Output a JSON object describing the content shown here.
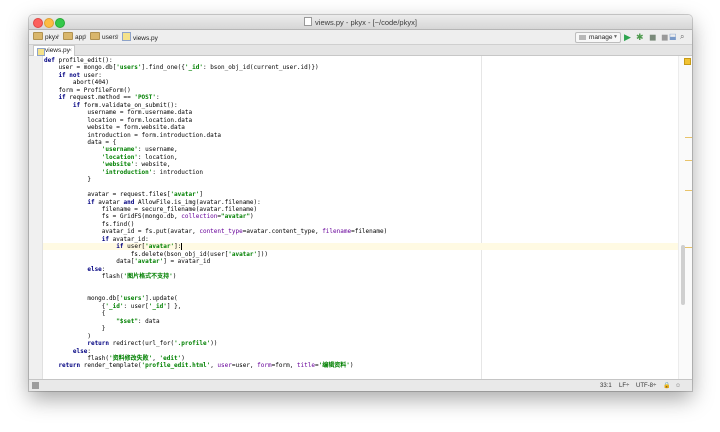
{
  "window": {
    "title": "views.py - pkyx - [~/code/pkyx]"
  },
  "breadcrumb": {
    "items": [
      {
        "label": "pkyx",
        "kind": "folder"
      },
      {
        "label": "app",
        "kind": "folder"
      },
      {
        "label": "users",
        "kind": "folder"
      },
      {
        "label": "views.py",
        "kind": "python-file"
      }
    ]
  },
  "toolbar": {
    "run_config": "manage",
    "icons": [
      "run-icon",
      "debug-icon",
      "coverage-icon",
      "stop-icon",
      "vcs-icon",
      "search-icon"
    ]
  },
  "tabs": [
    {
      "label": "views.py",
      "active": true
    }
  ],
  "editor": {
    "lines": [
      [
        [
          "kw",
          "def "
        ],
        [
          "",
          "profile_edit():"
        ]
      ],
      [
        [
          "",
          "    user = mongo.db["
        ],
        [
          "st",
          "'users'"
        ],
        [
          "",
          "].find_one({"
        ],
        [
          "st",
          "'_id'"
        ],
        [
          "",
          ": bson_obj_id(current_user.id)})"
        ]
      ],
      [
        [
          "kw",
          "    if not "
        ],
        [
          "",
          "user:"
        ]
      ],
      [
        [
          "",
          "        abort("
        ],
        [
          "",
          "404"
        ],
        [
          "",
          ")"
        ]
      ],
      [
        [
          "",
          "    form = ProfileForm()"
        ]
      ],
      [
        [
          "kw",
          "    if "
        ],
        [
          "",
          "request.method == "
        ],
        [
          "st",
          "'POST'"
        ],
        [
          "",
          ":"
        ]
      ],
      [
        [
          "kw",
          "        if "
        ],
        [
          "",
          "form.validate_on_submit():"
        ]
      ],
      [
        [
          "",
          "            username = form.username.data"
        ]
      ],
      [
        [
          "",
          "            location = form.location.data"
        ]
      ],
      [
        [
          "",
          "            website = form.website.data"
        ]
      ],
      [
        [
          "",
          "            introduction = form.introduction.data"
        ]
      ],
      [
        [
          "",
          "            data = {"
        ]
      ],
      [
        [
          "st",
          "                'username'"
        ],
        [
          "",
          ": username,"
        ]
      ],
      [
        [
          "st",
          "                'location'"
        ],
        [
          "",
          ": location,"
        ]
      ],
      [
        [
          "st",
          "                'website'"
        ],
        [
          "",
          ": website,"
        ]
      ],
      [
        [
          "st",
          "                'introduction'"
        ],
        [
          "",
          ": introduction"
        ]
      ],
      [
        [
          "",
          "            }"
        ]
      ],
      [
        [
          "",
          ""
        ]
      ],
      [
        [
          "",
          "            avatar = request.files["
        ],
        [
          "st",
          "'avatar'"
        ],
        [
          "",
          "]"
        ]
      ],
      [
        [
          "kw",
          "            if "
        ],
        [
          "",
          "avatar "
        ],
        [
          "kw",
          "and "
        ],
        [
          "",
          "AllowFile.is_img(avatar.filename):"
        ]
      ],
      [
        [
          "",
          "                filename = secure_filename(avatar.filename)"
        ]
      ],
      [
        [
          "",
          "                fs = GridFS(mongo.db, "
        ],
        [
          "pm",
          "collection"
        ],
        [
          "",
          "="
        ],
        [
          "st",
          "\"avatar\""
        ],
        [
          "",
          ")"
        ]
      ],
      [
        [
          "",
          "                fs.find()"
        ]
      ],
      [
        [
          "",
          "                avatar_id = fs.put(avatar, "
        ],
        [
          "pm",
          "content_type"
        ],
        [
          "",
          "=avatar.content_type, "
        ],
        [
          "pm",
          "filename"
        ],
        [
          "",
          "=filename)"
        ]
      ],
      [
        [
          "kw",
          "                if "
        ],
        [
          "",
          "avatar_id:"
        ]
      ],
      [
        [
          "kw",
          "                    if "
        ],
        [
          "",
          "user["
        ],
        [
          "st",
          "'avatar'"
        ],
        [
          "",
          "]:"
        ],
        [
          "cursor",
          ""
        ]
      ],
      [
        [
          "",
          "                        fs.delete(bson_obj_id(user["
        ],
        [
          "st",
          "'avatar'"
        ],
        [
          "",
          "]))"
        ]
      ],
      [
        [
          "",
          "                    data["
        ],
        [
          "st",
          "'avatar'"
        ],
        [
          "",
          "] = avatar_id"
        ]
      ],
      [
        [
          "kw",
          "            else"
        ],
        [
          "",
          ":"
        ]
      ],
      [
        [
          "",
          "                flash("
        ],
        [
          "st",
          "'图片格式不支持'"
        ],
        [
          "",
          ")"
        ]
      ],
      [
        [
          "",
          ""
        ]
      ],
      [
        [
          "",
          ""
        ]
      ],
      [
        [
          "",
          "            mongo.db["
        ],
        [
          "st",
          "'users'"
        ],
        [
          "",
          "].update("
        ]
      ],
      [
        [
          "",
          "                {"
        ],
        [
          "st",
          "'_id'"
        ],
        [
          "",
          ": user["
        ],
        [
          "st",
          "'_id'"
        ],
        [
          "",
          "] },"
        ]
      ],
      [
        [
          "",
          "                {"
        ]
      ],
      [
        [
          "st",
          "                    \"$set\""
        ],
        [
          "",
          ": data"
        ]
      ],
      [
        [
          "",
          "                }"
        ]
      ],
      [
        [
          "",
          "            )"
        ]
      ],
      [
        [
          "kw",
          "            return "
        ],
        [
          "",
          "redirect(url_for("
        ],
        [
          "st",
          "'.profile'"
        ],
        [
          "",
          "))"
        ]
      ],
      [
        [
          "kw",
          "        else"
        ],
        [
          "",
          ":"
        ]
      ],
      [
        [
          "",
          "            flash("
        ],
        [
          "st",
          "'资料修改失败'"
        ],
        [
          "",
          ", "
        ],
        [
          "st",
          "'edit'"
        ],
        [
          "",
          ")"
        ]
      ],
      [
        [
          "kw",
          "    return "
        ],
        [
          "",
          "render_template("
        ],
        [
          "st",
          "'profile_edit.html'"
        ],
        [
          "",
          ", "
        ],
        [
          "pm",
          "user"
        ],
        [
          "",
          "=user, "
        ],
        [
          "pm",
          "form"
        ],
        [
          "",
          "=form, "
        ],
        [
          "pm",
          "title"
        ],
        [
          "",
          "="
        ],
        [
          "st",
          "'编辑资料'"
        ],
        [
          "",
          ")"
        ]
      ]
    ]
  },
  "status": {
    "position": "33:1",
    "line_sep": "LF÷",
    "encoding": "UTF-8÷"
  },
  "colors": {
    "keyword": "#000080",
    "string": "#008000",
    "param": "#660099",
    "run_green": "#2ea44f"
  }
}
